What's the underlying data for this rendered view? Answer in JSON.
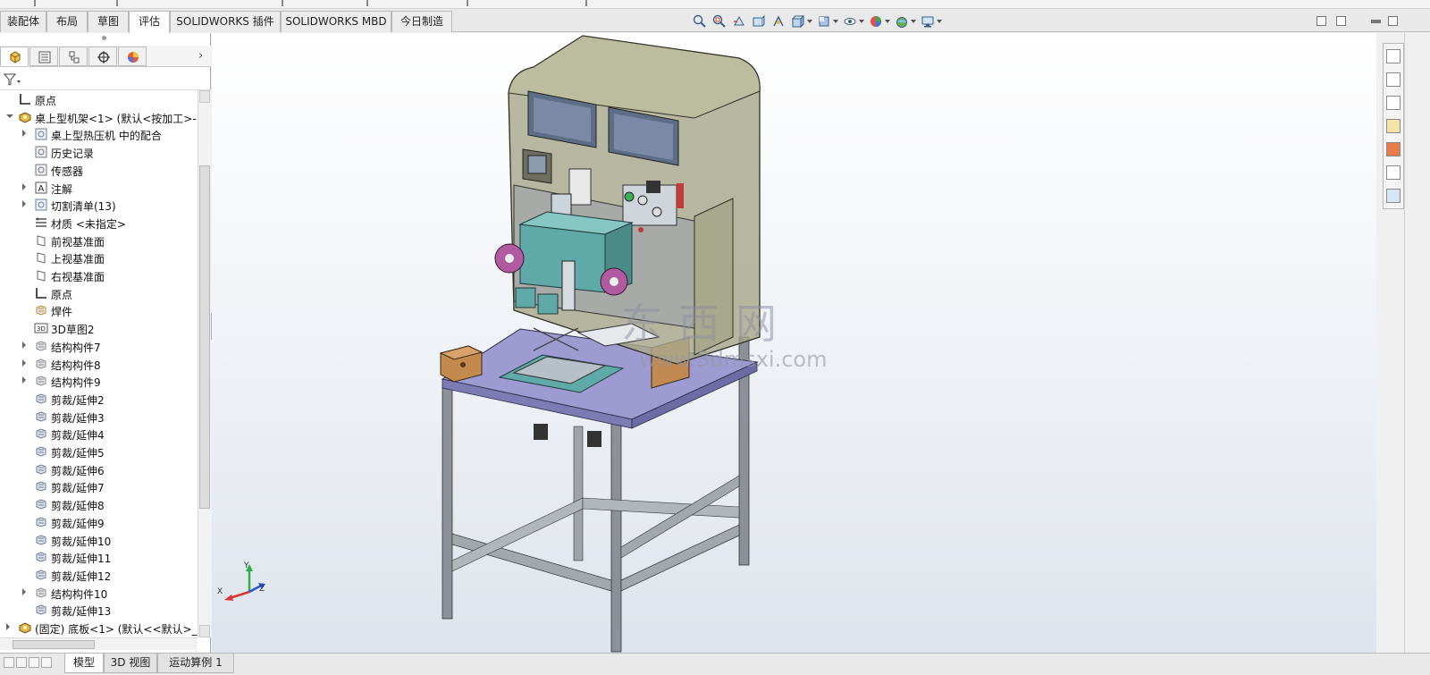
{
  "command_manager": {
    "tabs": [
      {
        "label": "装配体",
        "active": false
      },
      {
        "label": "布局",
        "active": false
      },
      {
        "label": "草图",
        "active": false
      },
      {
        "label": "评估",
        "active": true
      },
      {
        "label": "SOLIDWORKS 插件",
        "active": false
      },
      {
        "label": "SOLIDWORKS MBD",
        "active": false
      },
      {
        "label": "今日制造",
        "active": false
      }
    ]
  },
  "view_toolbar": {
    "icons": [
      "zoom-to-fit-icon",
      "zoom-to-area-icon",
      "previous-view-icon",
      "section-view-icon",
      "view-orientation-icon",
      "display-style-icon",
      "hide-show-items-icon",
      "edit-appearance-icon",
      "apply-scene-icon",
      "view-settings-icon"
    ]
  },
  "feature_manager": {
    "tabs": [
      "feature-manager-tab",
      "property-manager-tab",
      "configuration-manager-tab",
      "dimxpert-manager-tab",
      "display-manager-tab"
    ],
    "tree": [
      {
        "label": "原点",
        "indent": 1,
        "caret": "none",
        "icon": "origin-icon"
      },
      {
        "label": "桌上型机架<1> (默认<按加工>-",
        "indent": 0,
        "caret": "down",
        "icon": "part-icon"
      },
      {
        "label": "桌上型热压机 中的配合",
        "indent": 2,
        "caret": "right",
        "icon": "mates-icon"
      },
      {
        "label": "历史记录",
        "indent": 2,
        "caret": "none",
        "icon": "history-icon"
      },
      {
        "label": "传感器",
        "indent": 2,
        "caret": "none",
        "icon": "sensor-icon"
      },
      {
        "label": "注解",
        "indent": 2,
        "caret": "right",
        "icon": "annotation-icon"
      },
      {
        "label": "切割清单(13)",
        "indent": 2,
        "caret": "right",
        "icon": "cut-list-icon"
      },
      {
        "label": "材质 <未指定>",
        "indent": 2,
        "caret": "none",
        "icon": "material-icon"
      },
      {
        "label": "前视基准面",
        "indent": 2,
        "caret": "none",
        "icon": "plane-icon"
      },
      {
        "label": "上视基准面",
        "indent": 2,
        "caret": "none",
        "icon": "plane-icon"
      },
      {
        "label": "右视基准面",
        "indent": 2,
        "caret": "none",
        "icon": "plane-icon"
      },
      {
        "label": "原点",
        "indent": 2,
        "caret": "none",
        "icon": "origin-icon"
      },
      {
        "label": "焊件",
        "indent": 2,
        "caret": "none",
        "icon": "weldment-icon"
      },
      {
        "label": "3D草图2",
        "indent": 2,
        "caret": "none",
        "icon": "sketch-3d-icon"
      },
      {
        "label": "结构构件7",
        "indent": 2,
        "caret": "right",
        "icon": "structural-member-icon"
      },
      {
        "label": "结构构件8",
        "indent": 2,
        "caret": "right",
        "icon": "structural-member-icon"
      },
      {
        "label": "结构构件9",
        "indent": 2,
        "caret": "right",
        "icon": "structural-member-icon"
      },
      {
        "label": "剪裁/延伸2",
        "indent": 2,
        "caret": "none",
        "icon": "trim-extend-icon"
      },
      {
        "label": "剪裁/延伸3",
        "indent": 2,
        "caret": "none",
        "icon": "trim-extend-icon"
      },
      {
        "label": "剪裁/延伸4",
        "indent": 2,
        "caret": "none",
        "icon": "trim-extend-icon"
      },
      {
        "label": "剪裁/延伸5",
        "indent": 2,
        "caret": "none",
        "icon": "trim-extend-icon"
      },
      {
        "label": "剪裁/延伸6",
        "indent": 2,
        "caret": "none",
        "icon": "trim-extend-icon"
      },
      {
        "label": "剪裁/延伸7",
        "indent": 2,
        "caret": "none",
        "icon": "trim-extend-icon"
      },
      {
        "label": "剪裁/延伸8",
        "indent": 2,
        "caret": "none",
        "icon": "trim-extend-icon"
      },
      {
        "label": "剪裁/延伸9",
        "indent": 2,
        "caret": "none",
        "icon": "trim-extend-icon"
      },
      {
        "label": "剪裁/延伸10",
        "indent": 2,
        "caret": "none",
        "icon": "trim-extend-icon"
      },
      {
        "label": "剪裁/延伸11",
        "indent": 2,
        "caret": "none",
        "icon": "trim-extend-icon"
      },
      {
        "label": "剪裁/延伸12",
        "indent": 2,
        "caret": "none",
        "icon": "trim-extend-icon"
      },
      {
        "label": "结构构件10",
        "indent": 2,
        "caret": "right",
        "icon": "structural-member-icon"
      },
      {
        "label": "剪裁/延伸13",
        "indent": 2,
        "caret": "none",
        "icon": "trim-extend-icon"
      },
      {
        "label": "(固定) 底板<1> (默认<<默认>_显",
        "indent": 0,
        "caret": "right",
        "icon": "part-icon"
      }
    ]
  },
  "graphics": {
    "triad": {
      "x": "X",
      "y": "Y",
      "z": "Z"
    },
    "watermark_cn": "东西网",
    "watermark_url": "www.3dmsxi.com"
  },
  "task_pane": {
    "icons": [
      "home-icon",
      "design-library-icon",
      "file-explorer-icon",
      "view-palette-icon",
      "appearances-icon",
      "custom-properties-icon",
      "forum-icon"
    ]
  },
  "bottom_tabs": [
    {
      "label": "模型",
      "active": true
    },
    {
      "label": "3D 视图",
      "active": false
    },
    {
      "label": "运动算例 1",
      "active": false
    }
  ],
  "colors": {
    "cabinet": "#a8a88c",
    "table_top": "#9d9bd2",
    "frame": "#8a8e96",
    "accent_cyan": "#5fa9a8",
    "accent_magenta": "#b05a9f",
    "screen": "#7a8aa6"
  }
}
